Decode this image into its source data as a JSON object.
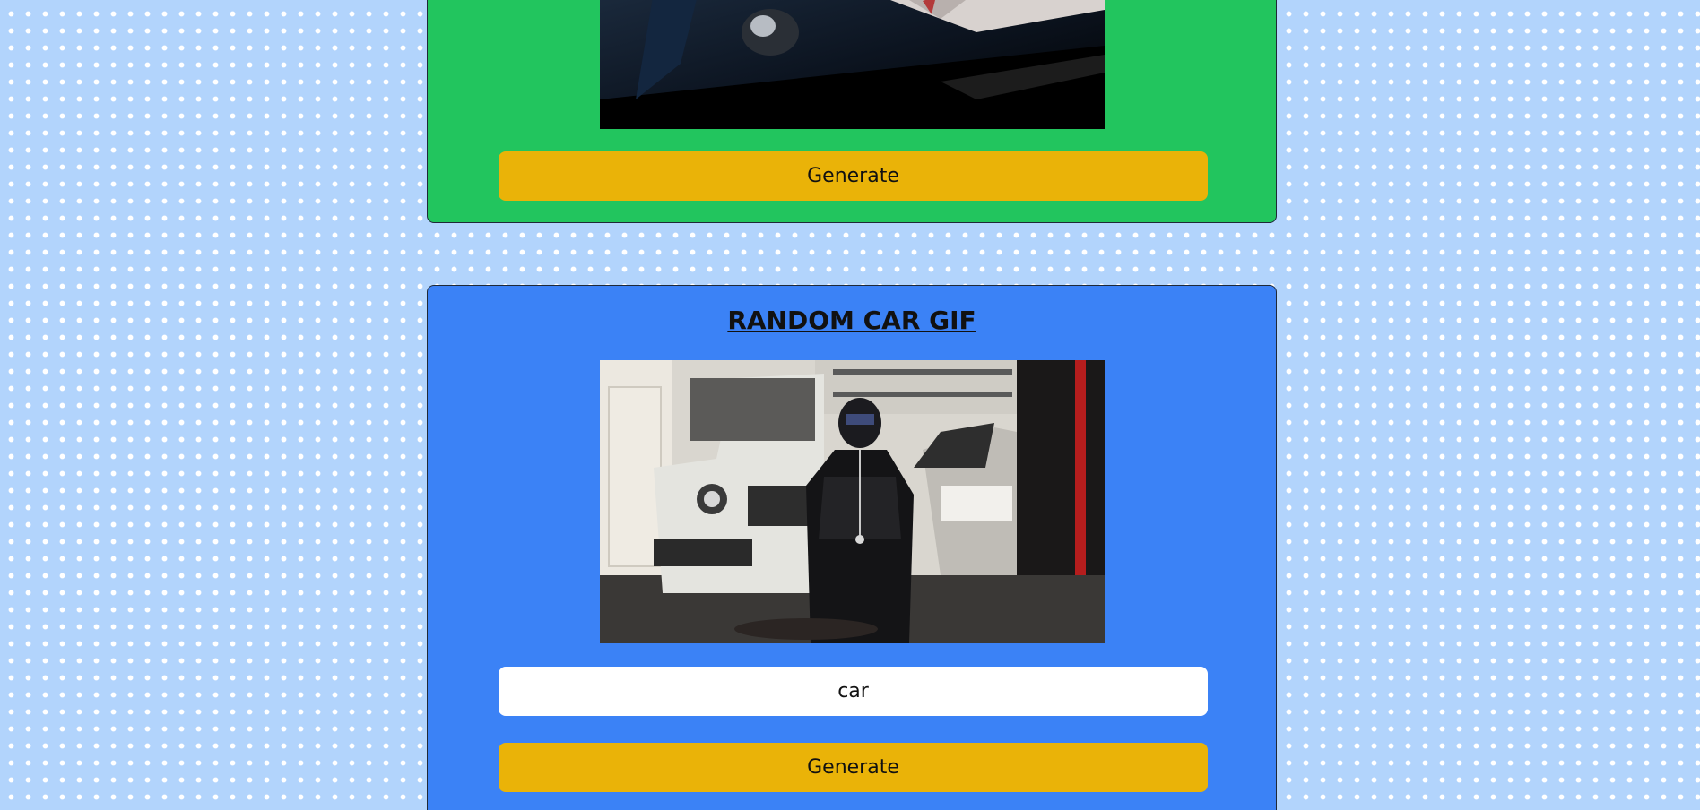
{
  "trending_card": {
    "button_label": "Generate",
    "gif_description_icon": "gif-image"
  },
  "car_card": {
    "title": "RANDOM CAR GIF",
    "tag_input_value": "car",
    "button_label": "Generate",
    "gif_description_icon": "gif-image"
  },
  "colors": {
    "page_background": "#b2d4fc",
    "trending_card_background": "#22c55e",
    "car_card_background": "#3b82f6",
    "button_background": "#eab308",
    "input_background": "#ffffff"
  }
}
